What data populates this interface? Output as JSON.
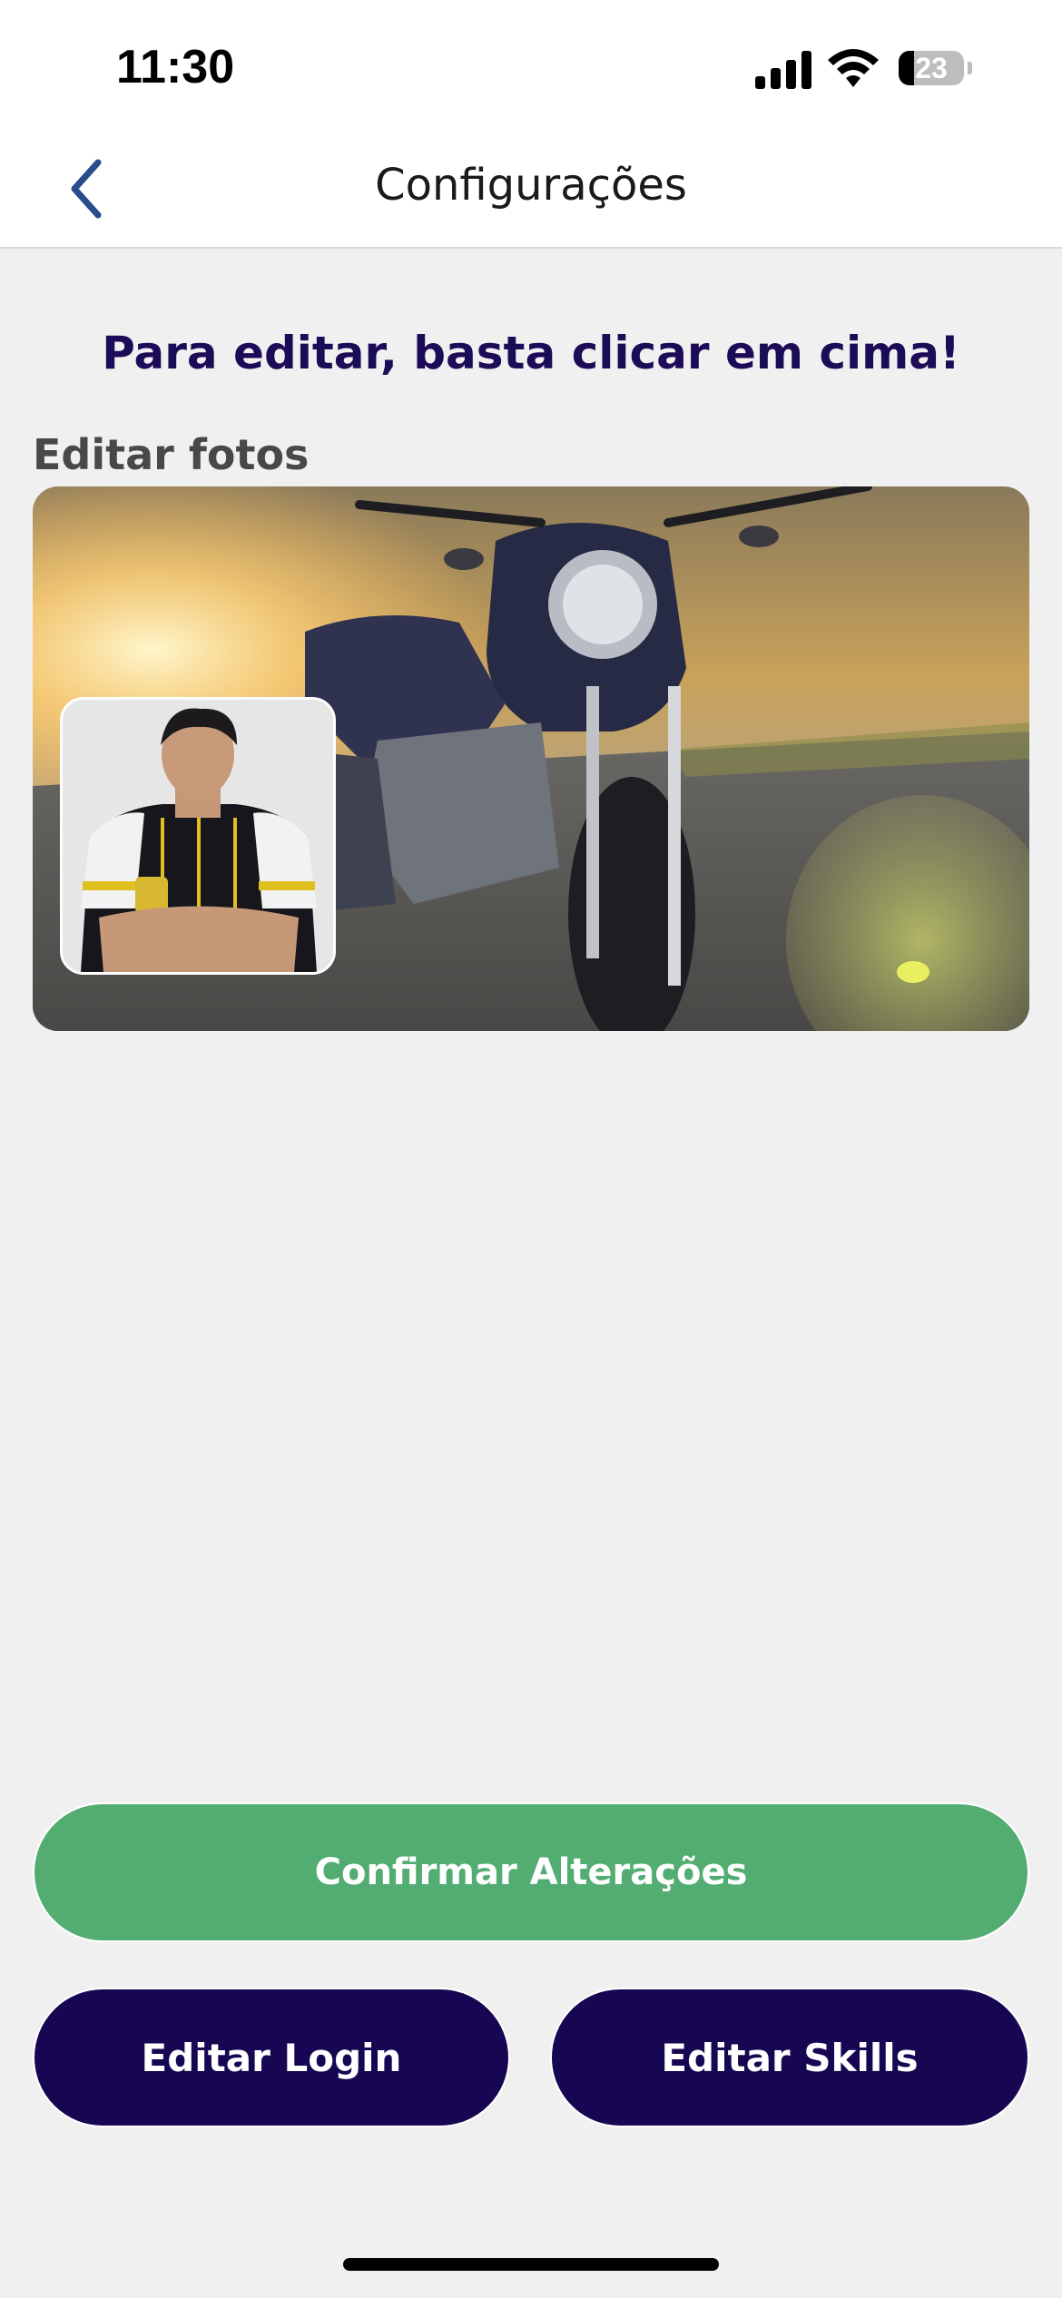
{
  "status_bar": {
    "time": "11:30",
    "battery_percent": "23",
    "battery_level": 0.23,
    "icons": [
      "signal-icon",
      "wifi-icon",
      "battery-icon"
    ]
  },
  "nav": {
    "title": "Configurações",
    "back_icon": "chevron-left-icon"
  },
  "instruction": "Para editar, basta clicar em cima!",
  "photos": {
    "section_label": "Editar fotos",
    "cover_alt": "motorcycle-cover-photo",
    "profile_alt": "profile-photo"
  },
  "actions": {
    "confirm_label": "Confirmar Alterações",
    "edit_login_label": "Editar Login",
    "edit_skills_label": "Editar Skills"
  },
  "colors": {
    "title_navy": "#1c0c57",
    "button_navy": "#170753",
    "confirm_green": "#53ad72",
    "background": "#f0f0f0",
    "back_arrow": "#2b4c8c"
  }
}
